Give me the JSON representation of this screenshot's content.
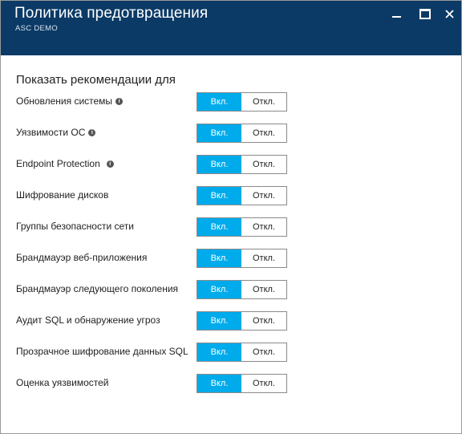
{
  "header": {
    "title": "Политика предотвращения",
    "subtitle": "ASC DEMO"
  },
  "window_controls": [
    "minimize-icon",
    "maximize-icon",
    "close-icon"
  ],
  "section": {
    "title": "Показать рекомендации для"
  },
  "toggle_labels": {
    "on": "Вкл.",
    "off": "Откл."
  },
  "recommendations": [
    {
      "label": "Обновления системы",
      "info": true,
      "state": "on"
    },
    {
      "label": "Уязвимости ОС",
      "info": true,
      "state": "on"
    },
    {
      "label": "Endpoint Protection",
      "info": true,
      "state": "on"
    },
    {
      "label": "Шифрование дисков",
      "info": false,
      "state": "on"
    },
    {
      "label": "Группы безопасности сети",
      "info": false,
      "state": "on"
    },
    {
      "label": "Брандмауэр веб-приложения",
      "info": false,
      "state": "on"
    },
    {
      "label": "Брандмауэр следующего поколения",
      "info": false,
      "state": "on"
    },
    {
      "label": "Аудит SQL и обнаружение угроз",
      "info": false,
      "state": "on"
    },
    {
      "label": "Прозрачное шифрование данных SQL",
      "info": false,
      "state": "on"
    },
    {
      "label": "Оценка уязвимостей",
      "info": false,
      "state": "on"
    }
  ],
  "colors": {
    "header": "#0b3a66",
    "accent": "#00abec"
  }
}
